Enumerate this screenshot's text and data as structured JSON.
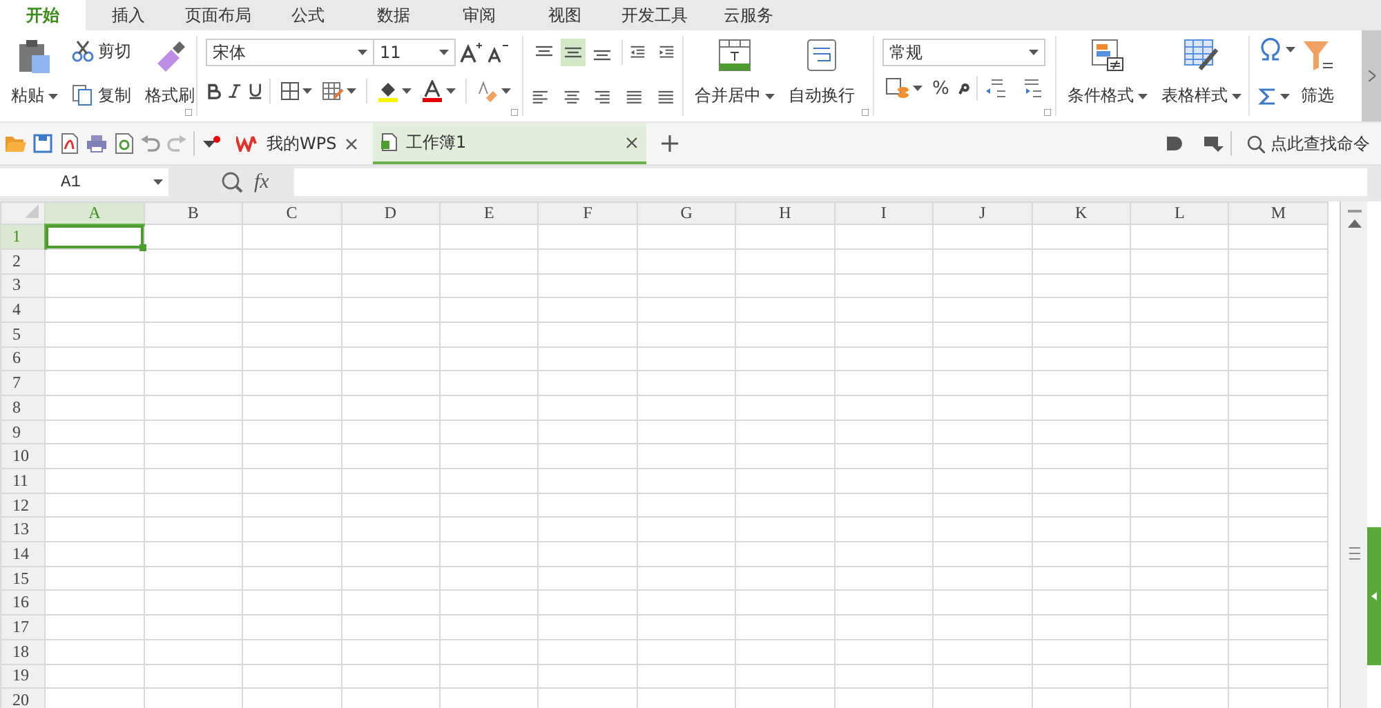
{
  "menu_tabs": [
    {
      "label": "开始",
      "selected": true
    },
    {
      "label": "插入",
      "selected": false
    },
    {
      "label": "页面布局",
      "selected": false
    },
    {
      "label": "公式",
      "selected": false
    },
    {
      "label": "数据",
      "selected": false
    },
    {
      "label": "审阅",
      "selected": false
    },
    {
      "label": "视图",
      "selected": false
    },
    {
      "label": "开发工具",
      "selected": false
    },
    {
      "label": "云服务",
      "selected": false
    }
  ],
  "ribbon": {
    "paste": "粘贴",
    "cut": "剪切",
    "copy": "复制",
    "format_painter": "格式刷",
    "font_name": "宋体",
    "font_size": "11",
    "vertical_align": [
      {
        "selected": false
      },
      {
        "selected": true
      },
      {
        "selected": false
      }
    ],
    "merge_center": "合并居中",
    "wrap_text": "自动换行",
    "number_format": "常规",
    "percent": "%",
    "conditional_format": "条件格式",
    "table_style": "表格样式",
    "filter": "筛选"
  },
  "doc_tabs": [
    {
      "label": "我的WPS",
      "selected": false
    },
    {
      "label": "工作簿1",
      "selected": true
    }
  ],
  "command_search": {
    "placeholder": "点此查找命令"
  },
  "formula_bar": {
    "cell_ref": "A1",
    "function_label": "fx"
  },
  "grid": {
    "columns": [
      {
        "label": "A",
        "selected": true
      },
      {
        "label": "B",
        "selected": false
      },
      {
        "label": "C",
        "selected": false
      },
      {
        "label": "D",
        "selected": false
      },
      {
        "label": "E",
        "selected": false
      },
      {
        "label": "F",
        "selected": false
      },
      {
        "label": "G",
        "selected": false
      },
      {
        "label": "H",
        "selected": false
      },
      {
        "label": "I",
        "selected": false
      },
      {
        "label": "J",
        "selected": false
      },
      {
        "label": "K",
        "selected": false
      },
      {
        "label": "L",
        "selected": false
      },
      {
        "label": "M",
        "selected": false
      }
    ],
    "rows": [
      {
        "label": "1",
        "selected": true
      },
      {
        "label": "2",
        "selected": false
      },
      {
        "label": "3",
        "selected": false
      },
      {
        "label": "4",
        "selected": false
      },
      {
        "label": "5",
        "selected": false
      },
      {
        "label": "6",
        "selected": false
      },
      {
        "label": "7",
        "selected": false
      },
      {
        "label": "8",
        "selected": false
      },
      {
        "label": "9",
        "selected": false
      },
      {
        "label": "10",
        "selected": false
      },
      {
        "label": "11",
        "selected": false
      },
      {
        "label": "12",
        "selected": false
      },
      {
        "label": "13",
        "selected": false
      },
      {
        "label": "14",
        "selected": false
      },
      {
        "label": "15",
        "selected": false
      },
      {
        "label": "16",
        "selected": false
      },
      {
        "label": "17",
        "selected": false
      },
      {
        "label": "18",
        "selected": false
      },
      {
        "label": "19",
        "selected": false
      },
      {
        "label": "20",
        "selected": false
      }
    ]
  }
}
